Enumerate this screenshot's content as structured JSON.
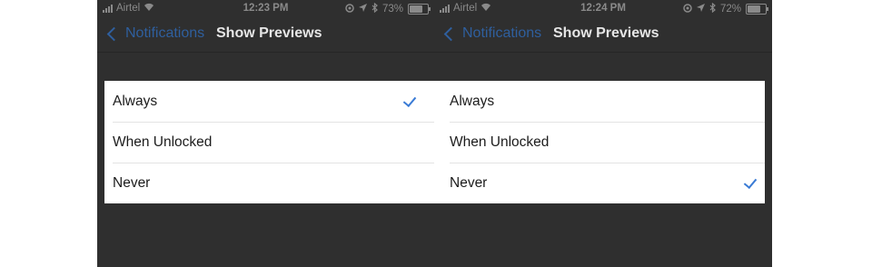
{
  "screens": [
    {
      "status": {
        "carrier": "Airtel",
        "time": "12:23 PM",
        "battery": "73%",
        "battery_level": 0.73
      },
      "nav": {
        "back_label": "Notifications",
        "title": "Show Previews"
      },
      "options": [
        {
          "label": "Always",
          "selected": true
        },
        {
          "label": "When Unlocked",
          "selected": false
        },
        {
          "label": "Never",
          "selected": false
        }
      ]
    },
    {
      "status": {
        "carrier": "Airtel",
        "time": "12:24 PM",
        "battery": "72%",
        "battery_level": 0.72
      },
      "nav": {
        "back_label": "Notifications",
        "title": "Show Previews"
      },
      "options": [
        {
          "label": "Always",
          "selected": false
        },
        {
          "label": "When Unlocked",
          "selected": false
        },
        {
          "label": "Never",
          "selected": true
        }
      ]
    }
  ],
  "colors": {
    "accent": "#3a7bd5",
    "background": "#2f2f2f"
  },
  "icons": [
    "signal-icon",
    "wifi-icon",
    "location-icon",
    "bluetooth-icon",
    "battery-icon",
    "checkmark-icon",
    "chevron-left-icon"
  ]
}
